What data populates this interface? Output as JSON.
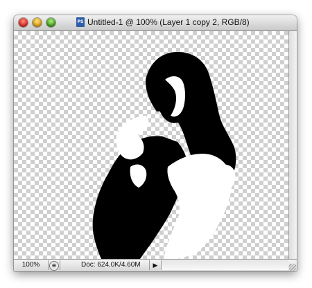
{
  "window": {
    "title": "Untitled-1 @ 100% (Layer 1 copy 2, RGB/8)",
    "doc_icon_label": "PS"
  },
  "statusbar": {
    "zoom": "100%",
    "doc_info": "Doc: 624.0K/4.60M"
  },
  "colors": {
    "window_bg": "#e8e8e8",
    "checker_light": "#ffffff",
    "checker_dark": "#cfcfcf",
    "figure": "#000000"
  },
  "icons": {
    "close": "close-icon",
    "minimize": "minimize-icon",
    "zoom": "zoom-icon",
    "document": "photoshop-document-icon",
    "status_menu": "play-arrow-icon",
    "resize": "resize-grip-icon"
  }
}
